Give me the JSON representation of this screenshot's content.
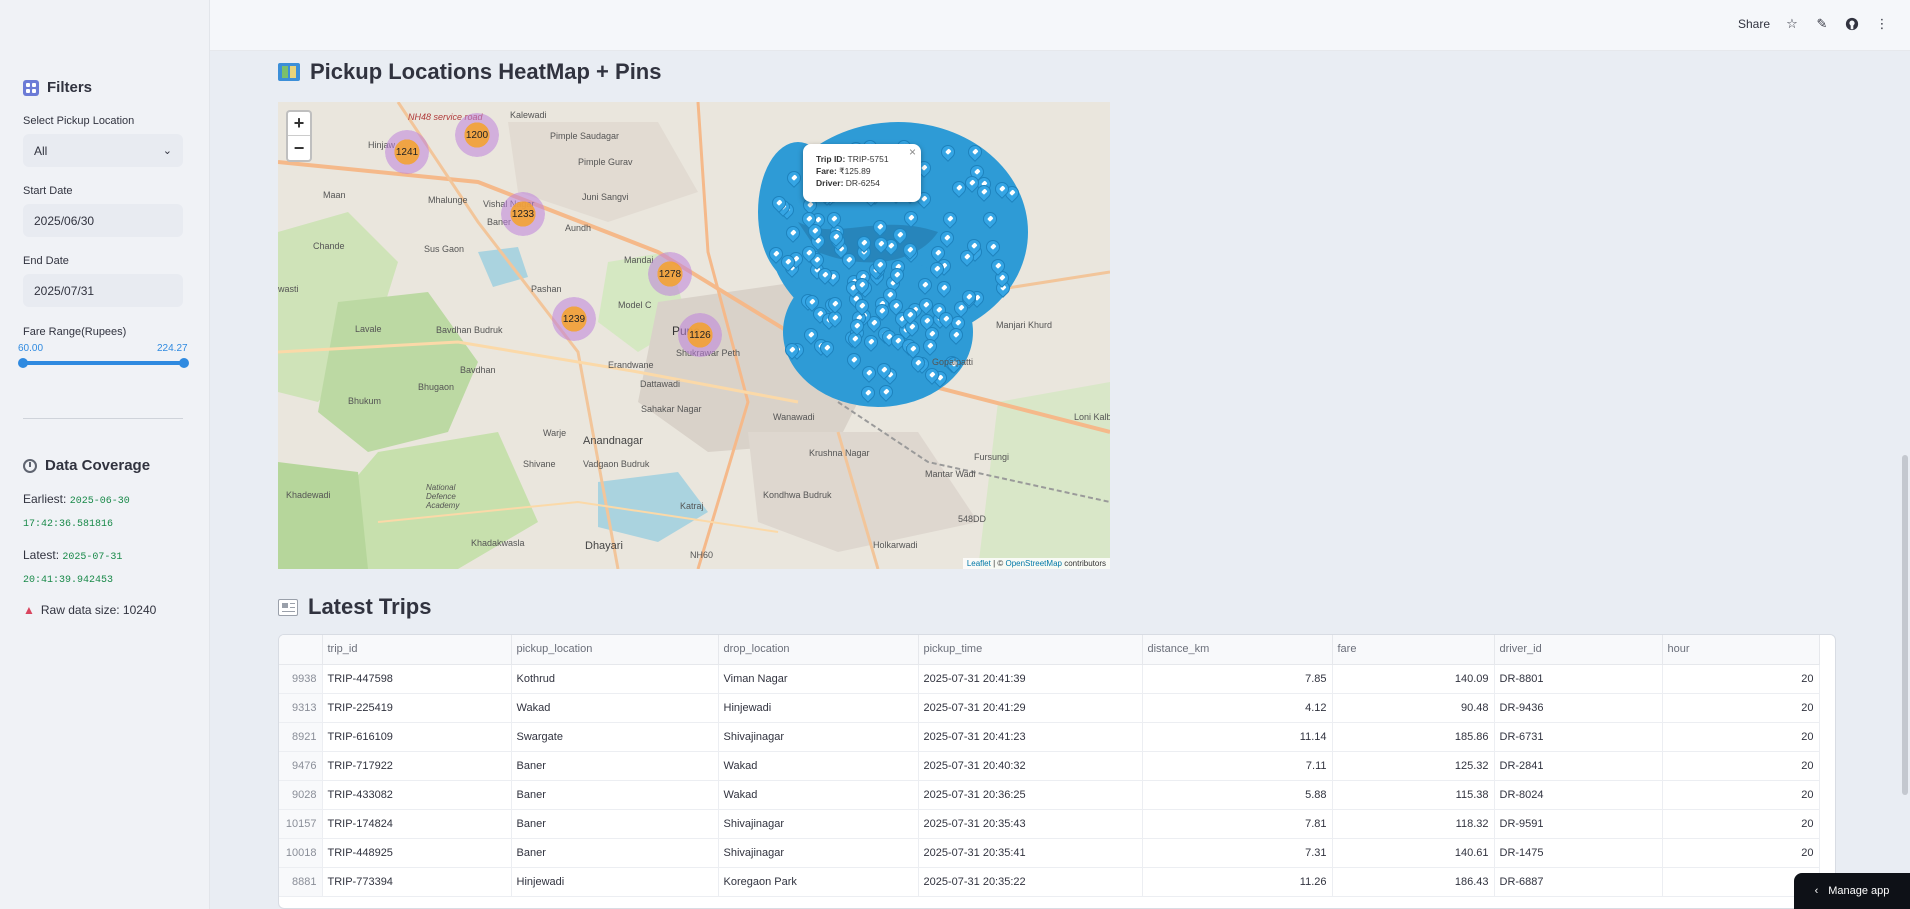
{
  "sidebar": {
    "filters_title": "Filters",
    "pickup_label": "Select Pickup Location",
    "pickup_value": "All",
    "start_label": "Start Date",
    "start_value": "2025/06/30",
    "end_label": "End Date",
    "end_value": "2025/07/31",
    "fare_label": "Fare Range(Rupees)",
    "fare_min": "60.00",
    "fare_max": "224.27",
    "coverage_title": "Data Coverage",
    "earliest_label": "Earliest:",
    "earliest_date": "2025-06-30",
    "earliest_time": "17:42:36.581816",
    "latest_label": "Latest:",
    "latest_date": "2025-07-31",
    "latest_time": "20:41:39.942453",
    "raw_size": "Raw data size: 10240"
  },
  "header": {
    "share_label": "Share"
  },
  "map_section": {
    "title": "Pickup Locations HeatMap + Pins",
    "zoom_in": "+",
    "zoom_out": "−",
    "clusters": [
      "1241",
      "1200",
      "1233",
      "1278",
      "1239",
      "1126"
    ],
    "places": [
      "Kalewadi",
      "Pimple Saudagar",
      "Hinjaw",
      "Vishal Nagar",
      "Pimple Gurav",
      "Juni Sangvi",
      "Maan",
      "Mhalunge",
      "Aundh",
      "Baner",
      "Chande",
      "Sus Gaon",
      "Pashan",
      "Model C",
      "Lavale",
      "Bavdhan Budruk",
      "Pune",
      "Shukrawar Peth",
      "Bavdhan",
      "Erandwane",
      "Bhugaon",
      "Dattawadi",
      "Bhukum",
      "Sahakar Nagar",
      "Warje",
      "Anandnagar",
      "Shivane",
      "Vadgaon Budruk",
      "Khadewadi",
      "National Defence Academy",
      "Katraj",
      "Khadakwasla",
      "Dhayari",
      "Kondhwa Budruk",
      "Wanawadi",
      "Krushna Nagar",
      "Manjari Khurd",
      "Gopalpatti",
      "Fursungi",
      "Mantar Wadi",
      "Holkarwadi",
      "Loni Kalbh",
      "NH60",
      "548DD",
      "NH48 service road",
      "Mandai",
      "wasti"
    ],
    "popup": {
      "trip_label": "Trip ID:",
      "trip_value": "TRIP-5751",
      "fare_label": "Fare:",
      "fare_value": "₹125.89",
      "driver_label": "Driver:",
      "driver_value": "DR-6254"
    },
    "attribution_leaflet": "Leaflet",
    "attribution_osm": "OpenStreetMap",
    "attribution_rest": "contributors"
  },
  "trips_section": {
    "title": "Latest Trips",
    "columns": [
      "",
      "trip_id",
      "pickup_location",
      "drop_location",
      "pickup_time",
      "distance_km",
      "fare",
      "driver_id",
      "hour"
    ],
    "rows": [
      [
        "9938",
        "TRIP-447598",
        "Kothrud",
        "Viman Nagar",
        "2025-07-31 20:41:39",
        "7.85",
        "140.09",
        "DR-8801",
        "20"
      ],
      [
        "9313",
        "TRIP-225419",
        "Wakad",
        "Hinjewadi",
        "2025-07-31 20:41:29",
        "4.12",
        "90.48",
        "DR-9436",
        "20"
      ],
      [
        "8921",
        "TRIP-616109",
        "Swargate",
        "Shivajinagar",
        "2025-07-31 20:41:23",
        "11.14",
        "185.86",
        "DR-6731",
        "20"
      ],
      [
        "9476",
        "TRIP-717922",
        "Baner",
        "Wakad",
        "2025-07-31 20:40:32",
        "7.11",
        "125.32",
        "DR-2841",
        "20"
      ],
      [
        "9028",
        "TRIP-433082",
        "Baner",
        "Wakad",
        "2025-07-31 20:36:25",
        "5.88",
        "115.38",
        "DR-8024",
        "20"
      ],
      [
        "10157",
        "TRIP-174824",
        "Baner",
        "Shivajinagar",
        "2025-07-31 20:35:43",
        "7.81",
        "118.32",
        "DR-9591",
        "20"
      ],
      [
        "10018",
        "TRIP-448925",
        "Baner",
        "Shivajinagar",
        "2025-07-31 20:35:41",
        "7.31",
        "140.61",
        "DR-1475",
        "20"
      ],
      [
        "8881",
        "TRIP-773394",
        "Hinjewadi",
        "Koregaon Park",
        "2025-07-31 20:35:22",
        "11.26",
        "186.43",
        "DR-6887",
        "20"
      ]
    ]
  },
  "manage_app": "Manage app",
  "colors": {
    "accent": "#2f8ae0",
    "pin": "#2e9bd6",
    "cluster": "#f0a03c"
  }
}
